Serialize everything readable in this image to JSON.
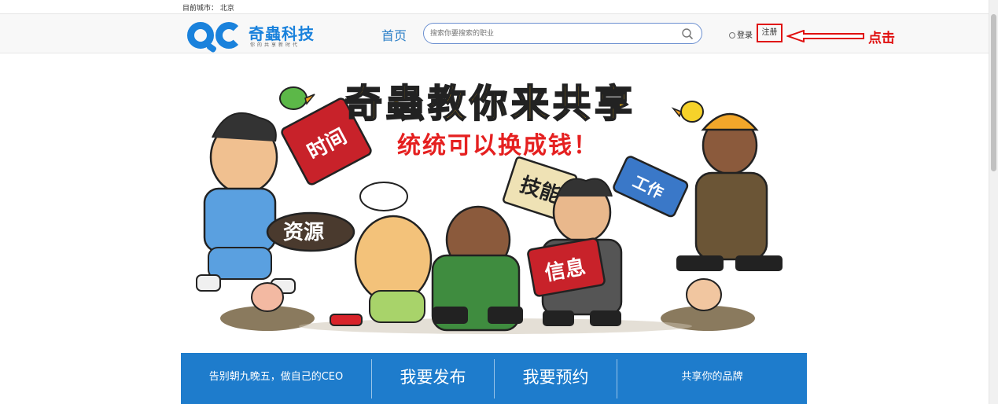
{
  "top": {
    "city_label": "目前城市：",
    "city": "北京"
  },
  "logo": {
    "text": "奇蟲科技",
    "tagline": "你的共享新时代"
  },
  "nav": {
    "home": "首页"
  },
  "search": {
    "placeholder": "搜索你要搜索的职业"
  },
  "auth": {
    "login": "登录",
    "register": "注册"
  },
  "annotation": {
    "label": "点击"
  },
  "banner": {
    "title": "奇蟲教你来共享",
    "subtitle": "统统可以换成钱！",
    "signs": [
      "时间",
      "资源",
      "技能",
      "信息"
    ],
    "book_label": "工作"
  },
  "bottom_bar": {
    "items": [
      "告别朝九晚五，做自己的CEO",
      "我要发布",
      "我要预约",
      "共享你的品牌"
    ]
  },
  "colors": {
    "accent": "#1e7ccc",
    "brand": "#1a82dc",
    "highlight": "#e01010",
    "title_yellow": "#f4b61a"
  }
}
